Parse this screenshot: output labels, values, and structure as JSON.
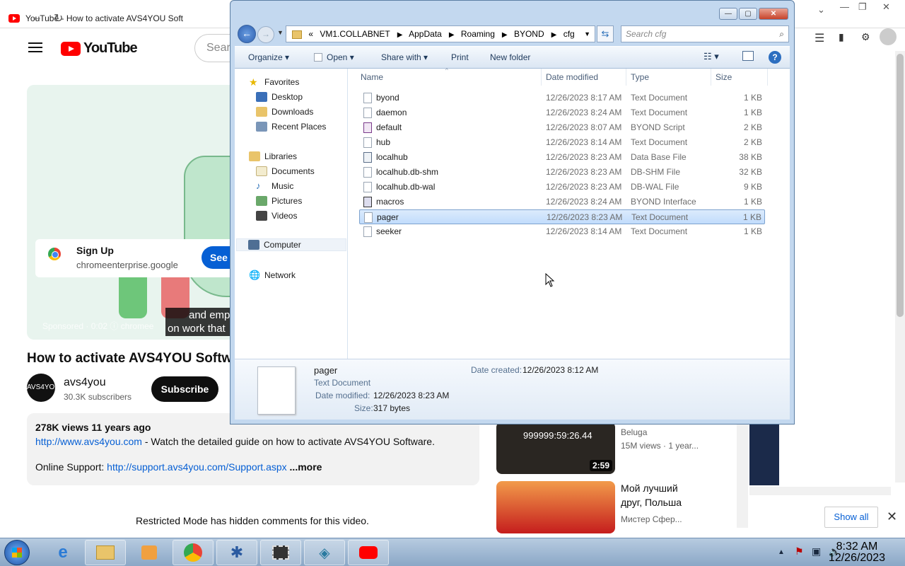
{
  "browser": {
    "tab_title": "YouTube - How to activate AVS4YOU Soft",
    "nav": {
      "back": "←",
      "forward": "→",
      "reload": "↻"
    }
  },
  "youtube": {
    "logo_text": "YouTube",
    "search_placeholder": "Sear",
    "ad": {
      "title": "Sign Up",
      "url": "chromeenterprise.google",
      "cta": "See m",
      "caption_line1": "and emp",
      "caption_line2": "on work that",
      "sponsored": "Sponsored · 0:02 ⓘ chromee"
    },
    "video_title": "How to activate AVS4YOU Softw",
    "channel": {
      "avatar": "AVS4YOU",
      "name": "avs4you",
      "subscribers": "30.3K subscribers",
      "subscribe_label": "Subscribe"
    },
    "description": {
      "views": "278K views  11 years ago",
      "link1": "http://www.avs4you.com",
      "text1": " - Watch the detailed guide on how to activate AVS4YOU Software.",
      "support_label": "Online Support: ",
      "link2": "http://support.avs4you.com/Support.aspx",
      "more": " ...more"
    },
    "restricted": "Restricted Mode has hidden comments for this video.",
    "side": [
      {
        "duration": "2:59",
        "overlay": "999999:59:26.44",
        "channel": "Beluga",
        "meta": "15M views · 1 year..."
      },
      {
        "title_line1": "Мой лучший",
        "title_line2": "друг, Польша",
        "channel": "Мистер Сфер..."
      }
    ],
    "show_all": "Show all",
    "close": "✕"
  },
  "explorer": {
    "window_buttons": {
      "minimize": "—",
      "maximize": "▢",
      "close": "✕"
    },
    "address": [
      "VM1.COLLABNET",
      "AppData",
      "Roaming",
      "BYOND",
      "cfg"
    ],
    "address_prefix": "«",
    "search_placeholder": "Search cfg",
    "toolbar": {
      "organize": "Organize ▾",
      "open": "Open ▾",
      "share": "Share with ▾",
      "print": "Print",
      "new_folder": "New folder"
    },
    "nav": {
      "favorites": "Favorites",
      "desktop": "Desktop",
      "downloads": "Downloads",
      "recent": "Recent Places",
      "libraries": "Libraries",
      "documents": "Documents",
      "music": "Music",
      "pictures": "Pictures",
      "videos": "Videos",
      "computer": "Computer",
      "network": "Network"
    },
    "columns": {
      "name": "Name",
      "date": "Date modified",
      "type": "Type",
      "size": "Size"
    },
    "files": [
      {
        "name": "byond",
        "date": "12/26/2023 8:17 AM",
        "type": "Text Document",
        "size": "1 KB",
        "icon": "text"
      },
      {
        "name": "daemon",
        "date": "12/26/2023 8:24 AM",
        "type": "Text Document",
        "size": "1 KB",
        "icon": "text"
      },
      {
        "name": "default",
        "date": "12/26/2023 8:07 AM",
        "type": "BYOND Script",
        "size": "2 KB",
        "icon": "script"
      },
      {
        "name": "hub",
        "date": "12/26/2023 8:14 AM",
        "type": "Text Document",
        "size": "2 KB",
        "icon": "text"
      },
      {
        "name": "localhub",
        "date": "12/26/2023 8:23 AM",
        "type": "Data Base File",
        "size": "38 KB",
        "icon": "db"
      },
      {
        "name": "localhub.db-shm",
        "date": "12/26/2023 8:23 AM",
        "type": "DB-SHM File",
        "size": "32 KB",
        "icon": "text"
      },
      {
        "name": "localhub.db-wal",
        "date": "12/26/2023 8:23 AM",
        "type": "DB-WAL File",
        "size": "9 KB",
        "icon": "text"
      },
      {
        "name": "macros",
        "date": "12/26/2023 8:24 AM",
        "type": "BYOND Interface",
        "size": "1 KB",
        "icon": "iface"
      },
      {
        "name": "pager",
        "date": "12/26/2023 8:23 AM",
        "type": "Text Document",
        "size": "1 KB",
        "icon": "text",
        "selected": true
      },
      {
        "name": "seeker",
        "date": "12/26/2023 8:14 AM",
        "type": "Text Document",
        "size": "1 KB",
        "icon": "text"
      }
    ],
    "details": {
      "name": "pager",
      "type": "Text Document",
      "modified_label": "Date modified:",
      "modified": "12/26/2023 8:23 AM",
      "size_label": "Size:",
      "size": "317 bytes",
      "created_label": "Date created:",
      "created": "12/26/2023 8:12 AM"
    }
  },
  "taskbar": {
    "apps": [
      "ie",
      "explorer",
      "media",
      "chrome",
      "byond",
      "video",
      "network",
      "youtube"
    ],
    "time": "8:32 AM",
    "date": "12/26/2023"
  }
}
